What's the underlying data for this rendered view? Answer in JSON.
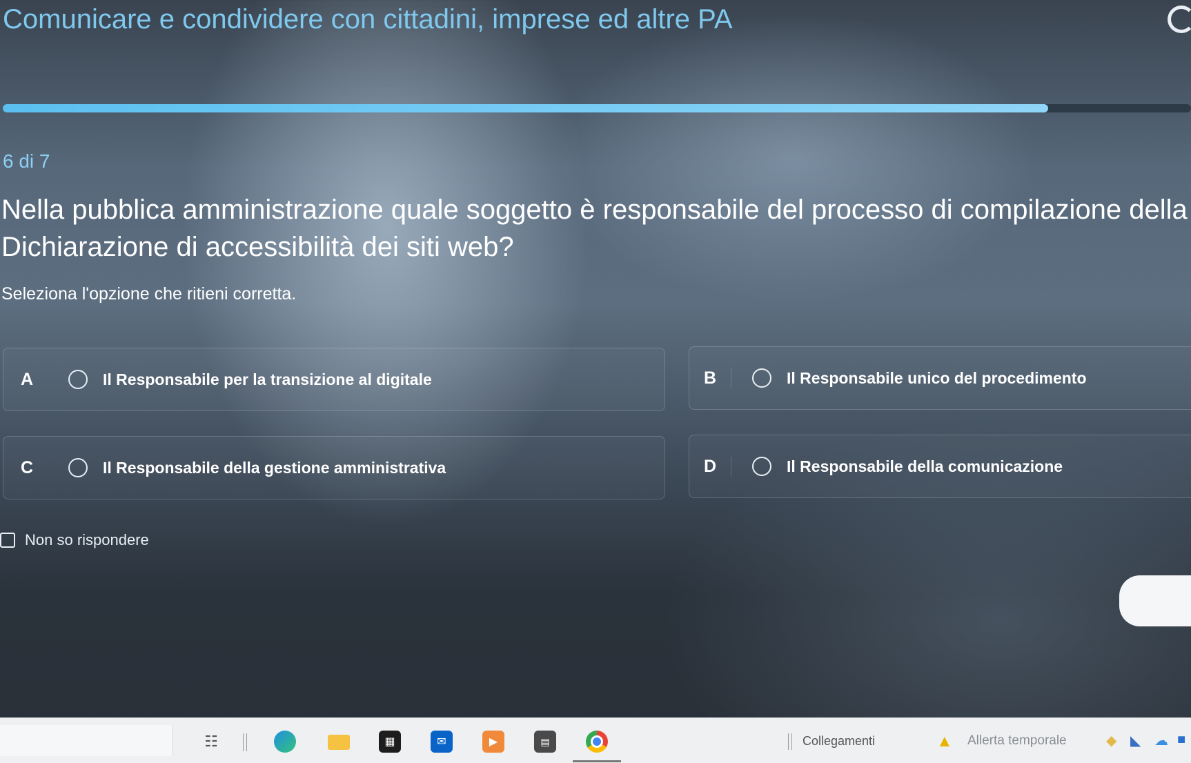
{
  "course": {
    "title": "Comunicare e condividere con cittadini, imprese ed altre PA"
  },
  "progress": {
    "fraction": 0.88
  },
  "quiz": {
    "step": "6 di 7",
    "question": "Nella pubblica amministrazione quale soggetto è responsabile del processo di compilazione della",
    "question_line2": "Dichiarazione di accessibilità dei siti web?",
    "instructions": "Seleziona l'opzione che ritieni corretta.",
    "options": [
      {
        "letter": "A",
        "label": "Il Responsabile per la transizione al digitale"
      },
      {
        "letter": "B",
        "label": "Il Responsabile unico del procedimento"
      },
      {
        "letter": "C",
        "label": "Il Responsabile della gestione amministrativa"
      },
      {
        "letter": "D",
        "label": "Il Responsabile della comunicazione"
      }
    ],
    "dont_know": "Non so rispondere"
  },
  "taskbar": {
    "links_label": "Collegamenti",
    "weather_label": "Allerta temporale",
    "icons": [
      "task-view-icon",
      "edge-icon",
      "file-explorer-icon",
      "store-icon",
      "outlook-icon",
      "media-player-icon",
      "calculator-icon",
      "chrome-icon"
    ]
  },
  "colors": {
    "accent": "#7fc8ee",
    "progress": "#5bc0f0"
  }
}
